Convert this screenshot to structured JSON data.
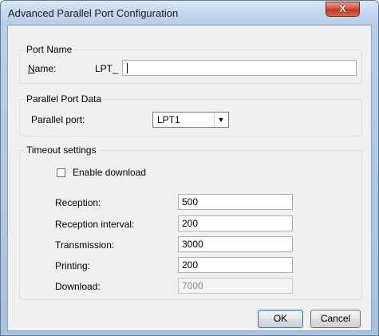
{
  "window": {
    "title": "Advanced Parallel Port Configuration",
    "close_glyph": "X"
  },
  "port_name": {
    "legend": "Port Name",
    "name_label_mnemonic": "N",
    "name_label_rest": "ame:",
    "prefix": "LPT_",
    "value": ""
  },
  "parallel_port_data": {
    "legend": "Parallel Port Data",
    "label": "Parallel port:",
    "selected": "LPT1",
    "arrow_glyph": "▼"
  },
  "timeout": {
    "legend": "Timeout settings",
    "enable_download_label": "Enable download",
    "enable_download_checked": false,
    "fields": [
      {
        "label": "Reception:",
        "value": "500",
        "enabled": true
      },
      {
        "label": "Reception interval:",
        "value": "200",
        "enabled": true
      },
      {
        "label": "Transmission:",
        "value": "3000",
        "enabled": true
      },
      {
        "label": "Printing:",
        "value": "200",
        "enabled": true
      },
      {
        "label": "Download:",
        "value": "7000",
        "enabled": false
      }
    ]
  },
  "buttons": {
    "ok": "OK",
    "cancel": "Cancel"
  }
}
